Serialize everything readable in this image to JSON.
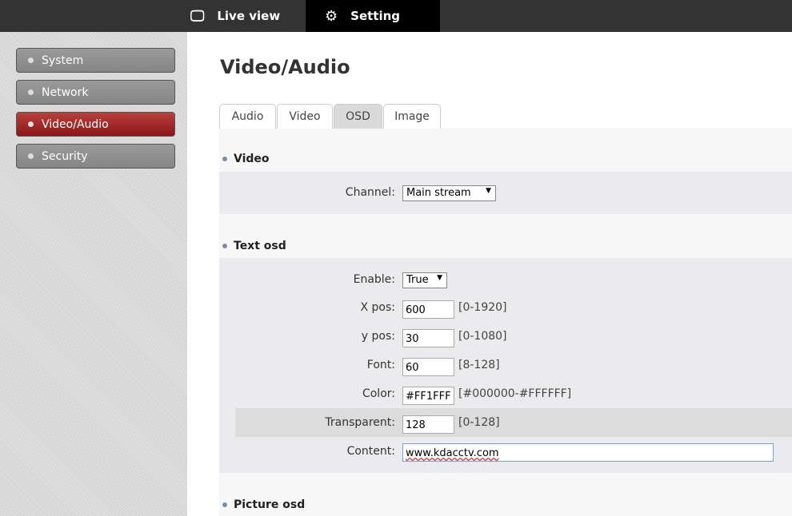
{
  "topnav": {
    "live_view": "Live view",
    "setting": "Setting"
  },
  "sidebar": {
    "items": [
      {
        "label": "System"
      },
      {
        "label": "Network"
      },
      {
        "label": "Video/Audio",
        "active": true
      },
      {
        "label": "Security"
      }
    ]
  },
  "page_title": "Video/Audio",
  "tabs": [
    {
      "label": "Audio"
    },
    {
      "label": "Video"
    },
    {
      "label": "OSD",
      "active": true
    },
    {
      "label": "Image"
    }
  ],
  "video": {
    "heading": "Video",
    "channel_label": "Channel:",
    "channel_value": "Main stream"
  },
  "text_osd": {
    "heading": "Text osd",
    "enable_label": "Enable:",
    "enable_value": "True",
    "xpos_label": "X pos:",
    "xpos_value": "600",
    "xpos_range": "[0-1920]",
    "ypos_label": "y pos:",
    "ypos_value": "30",
    "ypos_range": "[0-1080]",
    "font_label": "Font:",
    "font_value": "60",
    "font_range": "[8-128]",
    "color_label": "Color:",
    "color_value": "#FF1FFF",
    "color_range": "[#000000-#FFFFFF]",
    "transparent_label": "Transparent:",
    "transparent_value": "128",
    "transparent_range": "[0-128]",
    "content_label": "Content:",
    "content_value": "www.kdacctv.com"
  },
  "picture_osd": {
    "heading": "Picture osd"
  },
  "colors": {
    "active_menu": "#a02a28",
    "topbar": "#333333"
  }
}
